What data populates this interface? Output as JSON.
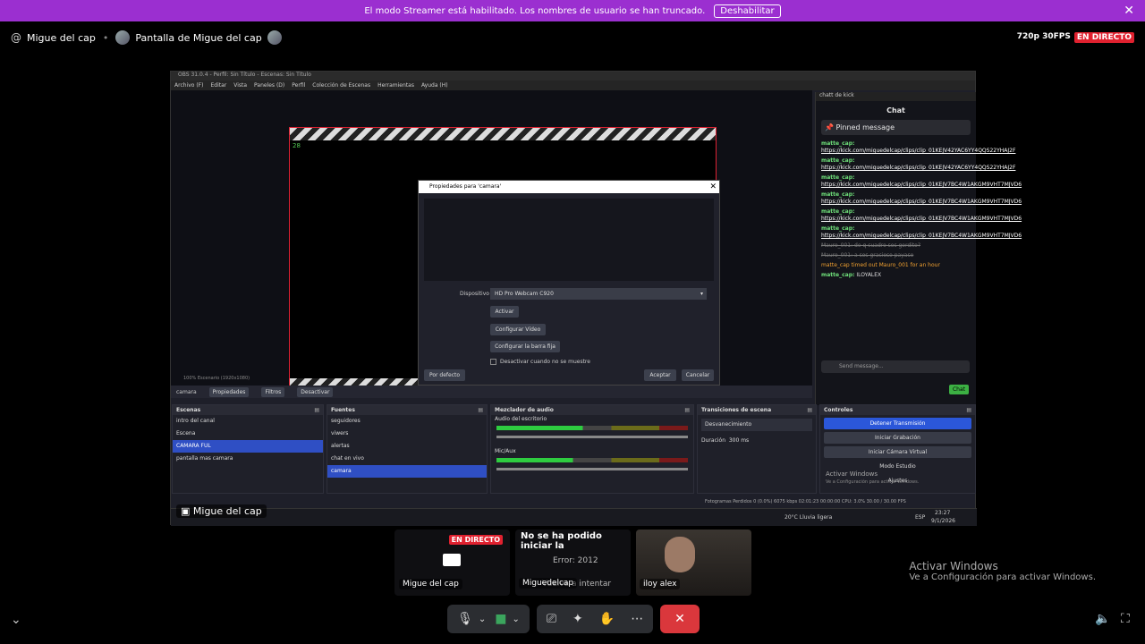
{
  "banner": {
    "text": "El modo Streamer está habilitado. Los nombres de usuario se han truncado.",
    "button": "Deshabilitar",
    "close": "✕"
  },
  "header": {
    "at": "@",
    "user": "Migue del cap",
    "sep": "•",
    "screen": "Pantalla de Migue del cap",
    "quality": "720p 30FPS",
    "live": "EN DIRECTO"
  },
  "obs": {
    "title": "OBS 31.0.4 - Perfil: Sin Título - Escenas: Sin Título",
    "menu": [
      "Archivo (F)",
      "Editar",
      "Vista",
      "Paneles (D)",
      "Perfil",
      "Colección de Escenas",
      "Herramientas",
      "Ayuda (H)"
    ],
    "cam_badge": "28",
    "preview_status": "100%   Escenario (1920x1080)",
    "source_bar": {
      "name": "camara",
      "props": "Propiedades",
      "filters": "Filtros",
      "deactivate": "Desactivar"
    },
    "dialog": {
      "title": "Propiedades para 'camara'",
      "device_label": "Dispositivo",
      "device_value": "HD Pro Webcam C920",
      "activate": "Activar",
      "config_video": "Configurar Vídeo",
      "config_bar": "Configurar la barra fija",
      "checkbox": "Desactivar cuando no se muestre",
      "defaults": "Por defecto",
      "accept": "Aceptar",
      "cancel": "Cancelar"
    },
    "scenes": {
      "title": "Escenas",
      "items": [
        "intro del canal",
        "Escena",
        "CAMARA FUL",
        "pantalla mas camara"
      ],
      "selected": 2
    },
    "sources": {
      "title": "Fuentes",
      "items": [
        "seguidores",
        "viwers",
        "alertas",
        "chat en vivo",
        "camara"
      ],
      "selected": 4
    },
    "mixer": {
      "title": "Mezclador de audio",
      "ch1": "Audio del escritorio",
      "ch2": "Mic/Aux",
      "db1": "0.0 dB",
      "db2": "0.0 dB"
    },
    "transitions": {
      "title": "Transiciones de escena",
      "type": "Desvanecimiento",
      "duration_label": "Duración",
      "duration": "300 ms"
    },
    "controls": {
      "title": "Controles",
      "items": [
        "Detener Transmisión",
        "Iniciar Grabación",
        "Iniciar Cámara Virtual",
        "Modo Estudio",
        "Ajustes"
      ]
    },
    "status": "Fotogramas Perdidos 0 (0.0%)   6075 kbps   02:01:23   00:00:00   CPU: 3.0%   30.00 / 30.00 FPS",
    "chat": {
      "dock": "chatt de kick",
      "title": "Chat",
      "pinned": "Pinned message",
      "messages": [
        {
          "user": "matte_cap:",
          "text": "https://kick.com/miguedelcap/clips/clip_01KEJV42YAC6YY4QQS22YHAJ2F"
        },
        {
          "user": "matte_cap:",
          "text": "https://kick.com/miguedelcap/clips/clip_01KEJV42YAC6YY4QQS22YHAJ2F"
        },
        {
          "user": "matte_cap:",
          "text": "https://kick.com/miguedelcap/clips/clip_01KEJV7BC4W1AKGM9VHT7MJVD6"
        },
        {
          "user": "matte_cap:",
          "text": "https://kick.com/miguedelcap/clips/clip_01KEJV7BC4W1AKGM9VHT7MJVD6"
        },
        {
          "user": "matte_cap:",
          "text": "https://kick.com/miguedelcap/clips/clip_01KEJV7BC4W1AKGM9VHT7MJVD6"
        },
        {
          "user": "matte_cap:",
          "text": "https://kick.com/miguedelcap/clips/clip_01KEJV7BC4W1AKGM9VHT7MJVD6"
        }
      ],
      "deleted1": "Mauro_001: de q cuadro sos gordito?",
      "deleted2": "Mauro_001: a sos gracioso payaso",
      "timeout": "matte_cap timed out Mauro_001 for an hour",
      "last_user": "matte_cap:",
      "last_text": "ILOYALEX",
      "input": "Send message...",
      "send": "Chat"
    },
    "taskbar": {
      "weather": "20°C  Lluvia ligera",
      "lang": "ESP",
      "time": "23:27",
      "date": "9/1/2026",
      "activate": "Activar Windows",
      "activate_sub": "Ve a Configuración para activar Windows."
    }
  },
  "stage_name": "Migue del cap",
  "tiles": [
    {
      "live": "EN DIRECTO",
      "name": "Migue del cap"
    },
    {
      "msg": "No se ha podido iniciar la",
      "err": "Error: 2012",
      "retry": "Vuelva a intentar",
      "name": "Miguedelcap"
    },
    {
      "name": "iloy alex"
    }
  ],
  "windows": {
    "line1": "Activar Windows",
    "line2": "Ve a Configuración para activar Windows."
  },
  "colors": {
    "accent": "#9b2fd0",
    "live": "#e0212f",
    "hangup": "#da373c"
  }
}
